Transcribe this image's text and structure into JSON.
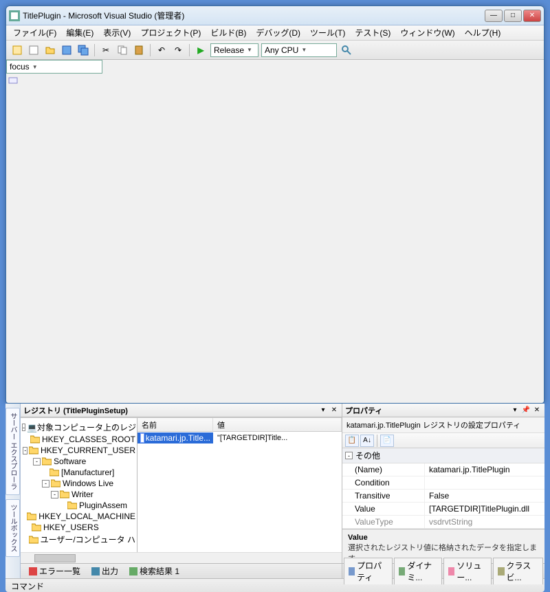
{
  "window": {
    "title": "TitlePlugin - Microsoft Visual Studio (管理者)"
  },
  "menu": {
    "file": "ファイル(F)",
    "edit": "編集(E)",
    "view": "表示(V)",
    "project": "プロジェクト(P)",
    "build": "ビルド(B)",
    "debug": "デバッグ(D)",
    "tools": "ツール(T)",
    "test": "テスト(S)",
    "window": "ウィンドウ(W)",
    "help": "ヘルプ(H)"
  },
  "toolbar": {
    "config": "Release",
    "platform": "Any CPU",
    "search": "focus"
  },
  "sidetabs": {
    "server": "サーバー エクスプローラ",
    "toolbox": "ツールボックス"
  },
  "registry": {
    "title": "レジストリ (TitlePluginSetup)",
    "tree": {
      "root": "対象コンピュータ上のレジスト",
      "hkcr": "HKEY_CLASSES_ROOT",
      "hkcu": "HKEY_CURRENT_USER",
      "software": "Software",
      "manufacturer": "[Manufacturer]",
      "winlive": "Windows Live",
      "writer": "Writer",
      "pluginasm": "PluginAssem",
      "hklm": "HKEY_LOCAL_MACHINE",
      "hku": "HKEY_USERS",
      "usercomp": "ユーザー/コンピュータ ハ"
    },
    "list": {
      "col_name": "名前",
      "col_value": "値",
      "row_name": "katamari.jp.Title...",
      "row_value": "\"[TARGETDIR]Title..."
    }
  },
  "properties": {
    "title": "プロパティ",
    "subtitle": "katamari.jp.TitlePlugin レジストリの設定プロパティ",
    "cat_other": "その他",
    "rows": {
      "name_k": "(Name)",
      "name_v": "katamari.jp.TitlePlugin",
      "cond_k": "Condition",
      "cond_v": "",
      "trans_k": "Transitive",
      "trans_v": "False",
      "value_k": "Value",
      "value_v": "[TARGETDIR]TitlePlugin.dll",
      "vtype_k": "ValueType",
      "vtype_v": "vsdrvtString"
    },
    "desc_title": "Value",
    "desc_body": "選択されたレジストリ値に格納されたデータを指定します。"
  },
  "prop_tabs": {
    "t1": "プロパティ",
    "t2": "ダイナミ...",
    "t3": "ソリュー...",
    "t4": "クラス ビ..."
  },
  "bottom": {
    "errors": "エラー一覧",
    "output": "出力",
    "search": "検索結果 1"
  },
  "status": {
    "cmd": "コマンド"
  }
}
